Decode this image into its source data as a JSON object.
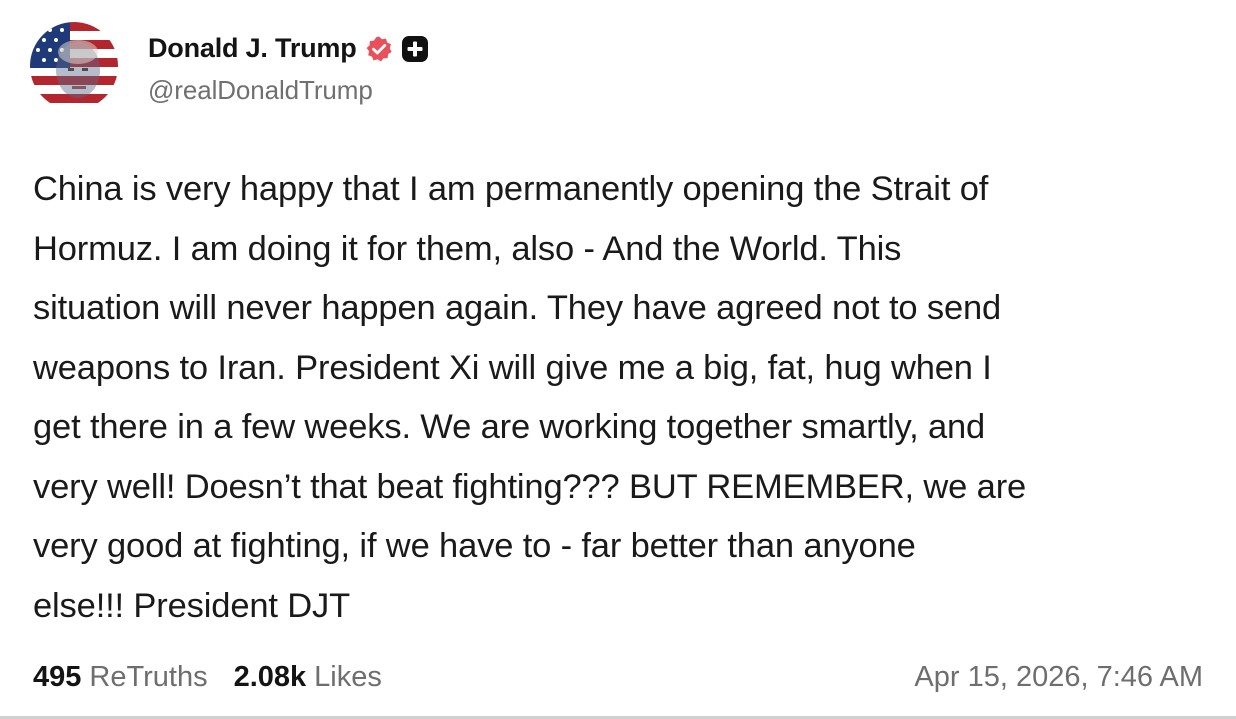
{
  "post": {
    "author": {
      "display_name": "Donald J. Trump",
      "handle": "@realDonaldTrump",
      "avatar_icon": "flag-portrait-avatar",
      "verified_icon": "verified-badge-icon",
      "plus_icon": "plus-badge-icon"
    },
    "body_lines": [
      "China is very happy that I am permanently opening the Strait of",
      "Hormuz. I am doing it for them, also - And the World. This",
      "situation will never happen again. They have agreed not to send",
      "weapons to Iran. President Xi will give me a big, fat, hug when I",
      "get there in a few weeks. We are working together smartly, and",
      "very well! Doesn’t that beat fighting??? BUT REMEMBER, we are",
      "very good at fighting, if we have to - far better than anyone",
      "else!!! President DJT"
    ],
    "stats": {
      "retruths_count": "495",
      "retruths_label": "ReTruths",
      "likes_count": "2.08k",
      "likes_label": "Likes"
    },
    "timestamp": "Apr 15, 2026, 7:46 AM"
  },
  "colors": {
    "verified_badge": "#e8505b",
    "plus_badge": "#111111",
    "secondary_text": "#6e6e6e",
    "primary_text": "#1a1a1a"
  }
}
